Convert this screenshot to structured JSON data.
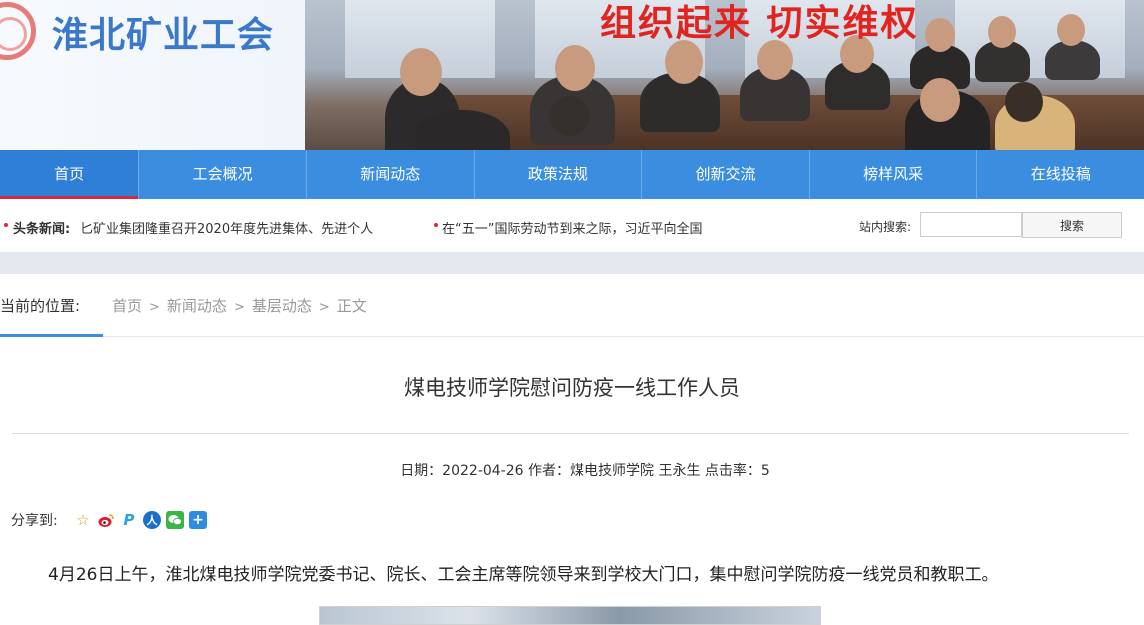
{
  "header": {
    "site_title": "淮北矿业工会",
    "slogan": "组织起来 切实维权",
    "colors": {
      "title": "#3b78c9",
      "slogan": "#e1241f",
      "nav": "#3b8de0",
      "active_underline": "#d6293e"
    }
  },
  "nav": {
    "items": [
      {
        "label": "首页",
        "active": true
      },
      {
        "label": "工会概况"
      },
      {
        "label": "新闻动态"
      },
      {
        "label": "政策法规"
      },
      {
        "label": "创新交流"
      },
      {
        "label": "榜样风采"
      },
      {
        "label": "在线投稿"
      }
    ]
  },
  "headline": {
    "label": "头条新闻:",
    "items": [
      "匕矿业集团隆重召开2020年度先进集体、先进个人",
      "在“五一”国际劳动节到来之际，习近平向全国"
    ]
  },
  "search": {
    "label": "站内搜索:",
    "value": "",
    "button": "搜索"
  },
  "breadcrumb": {
    "title": "当前的位置:",
    "items": [
      "首页",
      "新闻动态",
      "基层动态",
      "正文"
    ],
    "separator": ">"
  },
  "article": {
    "title": "煤电技师学院慰问防疫一线工作人员",
    "meta": "日期：2022-04-26 作者：煤电技师学院 王永生 点击率：5",
    "share_label": "分享到:",
    "share_icons": [
      "star-icon",
      "weibo-icon",
      "p-icon",
      "renren-icon",
      "wechat-icon",
      "plus-icon"
    ],
    "body": "4月26日上午，淮北煤电技师学院党委书记、院长、工会主席等院领导来到学校大门口，集中慰问学院防疫一线党员和教职工。"
  }
}
